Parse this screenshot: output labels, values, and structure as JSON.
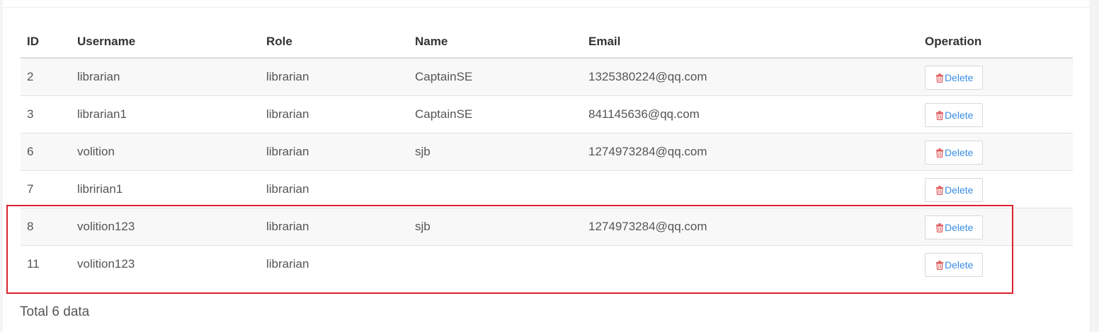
{
  "table": {
    "columns": [
      "ID",
      "Username",
      "Role",
      "Name",
      "Email",
      "Operation"
    ],
    "rows": [
      {
        "id": "2",
        "username": "librarian",
        "role": "librarian",
        "name": "CaptainSE",
        "email": "1325380224@qq.com",
        "action": "Delete"
      },
      {
        "id": "3",
        "username": "librarian1",
        "role": "librarian",
        "name": "CaptainSE",
        "email": "841145636@qq.com",
        "action": "Delete"
      },
      {
        "id": "6",
        "username": "volition",
        "role": "librarian",
        "name": "sjb",
        "email": "1274973284@qq.com",
        "action": "Delete"
      },
      {
        "id": "7",
        "username": "libririan1",
        "role": "librarian",
        "name": "",
        "email": "",
        "action": "Delete"
      },
      {
        "id": "8",
        "username": "volition123",
        "role": "librarian",
        "name": "sjb",
        "email": "1274973284@qq.com",
        "action": "Delete"
      },
      {
        "id": "11",
        "username": "volition123",
        "role": "librarian",
        "name": "",
        "email": "",
        "action": "Delete"
      }
    ]
  },
  "footer": {
    "total_text": "Total 6 data"
  },
  "icons": {
    "delete": "trash-icon"
  },
  "colors": {
    "delete_text": "#3a8ee6",
    "trash_icon": "#e05a5a",
    "highlight_border": "#d9232e"
  }
}
